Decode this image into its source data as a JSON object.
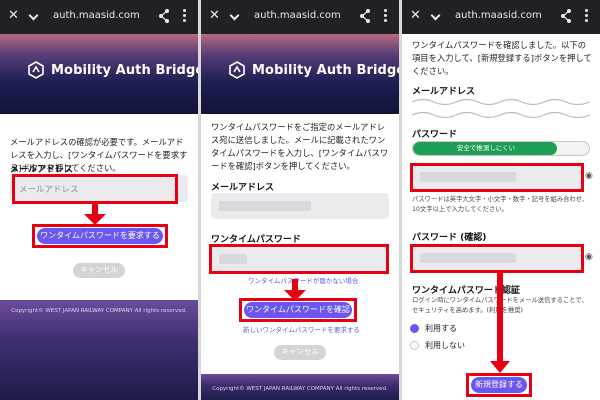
{
  "browser": {
    "url": "auth.maasid.com"
  },
  "brand": {
    "name": "Mobility Auth Bridge"
  },
  "footer": {
    "copyright": "Copyright© WEST JAPAN RAILWAY COMPANY All rights reserved."
  },
  "colors": {
    "accent": "#6b57f0",
    "highlight": "#e60012",
    "strength": "#1e9e54",
    "hero_dark": "#12123a"
  },
  "screen1": {
    "message": "メールアドレスの確認が必要です。メールアドレスを入力し、[ワンタイムパスワードを要求する]ボタンを押してください。",
    "email_label": "メールアドレス",
    "email_placeholder": "メールアドレス",
    "request_otp_button": "ワンタイムパスワードを要求する",
    "cancel_button": "キャンセル"
  },
  "screen2": {
    "message": "ワンタイムパスワードをご指定のメールアドレス宛に送信しました。メールに記載されたワンタイムパスワードを入力し、[ワンタイムパスワードを確認]ボタンを押してください。",
    "email_label": "メールアドレス",
    "otp_label": "ワンタイムパスワード",
    "otp_not_received_link": "ワンタイムパスワードが届かない場合",
    "confirm_otp_button": "ワンタイムパスワードを確認",
    "request_new_otp_link": "新しいワンタイムパスワードを要求する",
    "cancel_button": "キャンセル"
  },
  "screen3": {
    "message": "ワンタイムパスワードを確認しました。以下の項目を入力して、[新規登録する]ボタンを押してください。",
    "email_label": "メールアドレス",
    "password_label": "パスワード",
    "strength_text": "安全で推測しにくい",
    "strength_fraction": 0.82,
    "password_hint": "パスワードは英字大文字・小文字・数字・記号を組み合わせ、10文字以上で入力してください。",
    "password_confirm_label": "パスワード (確認)",
    "otp_auth_label": "ワンタイムパスワード認証",
    "otp_auth_description": "ログイン時にワンタイムパスワードをメール送信することで、セキュリティを高めます。(利用を推奨)",
    "option_use": "利用する",
    "option_no_use": "利用しない",
    "register_button": "新規登録する"
  }
}
